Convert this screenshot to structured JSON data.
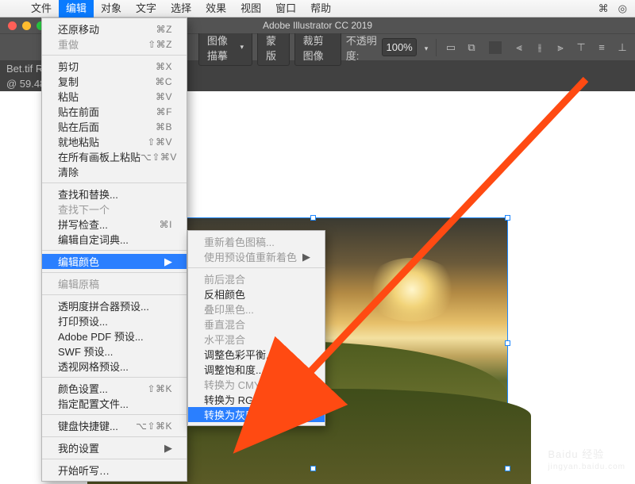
{
  "menubar": {
    "items": [
      "文件",
      "编辑",
      "对象",
      "文字",
      "选择",
      "效果",
      "视图",
      "窗口",
      "帮助"
    ],
    "active_index": 1
  },
  "app": {
    "title": "Adobe Illustrator CC 2019"
  },
  "toolbar": {
    "btn_trace": "图像描摹",
    "btn_mask": "蒙版",
    "btn_crop": "裁剪图像",
    "opacity_label": "不透明度:",
    "opacity_value": "100%"
  },
  "doc": {
    "tab": "Bet.tif    RG",
    "status": "@ 59.48% ⋯"
  },
  "menu_edit": [
    {
      "t": "还原移动",
      "sc": "⌘Z"
    },
    {
      "t": "重做",
      "sc": "⇧⌘Z",
      "disabled": true
    },
    {
      "sep": true
    },
    {
      "t": "剪切",
      "sc": "⌘X"
    },
    {
      "t": "复制",
      "sc": "⌘C"
    },
    {
      "t": "粘贴",
      "sc": "⌘V"
    },
    {
      "t": "贴在前面",
      "sc": "⌘F"
    },
    {
      "t": "贴在后面",
      "sc": "⌘B"
    },
    {
      "t": "就地粘贴",
      "sc": "⇧⌘V"
    },
    {
      "t": "在所有画板上粘贴",
      "sc": "⌥⇧⌘V"
    },
    {
      "t": "清除"
    },
    {
      "sep": true
    },
    {
      "t": "查找和替换..."
    },
    {
      "t": "查找下一个",
      "disabled": true
    },
    {
      "t": "拼写检查...",
      "sc": "⌘I"
    },
    {
      "t": "编辑自定词典..."
    },
    {
      "sep": true
    },
    {
      "t": "编辑颜色",
      "sub": true,
      "hi": true
    },
    {
      "sep": true
    },
    {
      "t": "编辑原稿",
      "disabled": true
    },
    {
      "sep": true
    },
    {
      "t": "透明度拼合器预设..."
    },
    {
      "t": "打印预设..."
    },
    {
      "t": "Adobe PDF 预设..."
    },
    {
      "t": "SWF 预设..."
    },
    {
      "t": "透视网格预设..."
    },
    {
      "sep": true
    },
    {
      "t": "颜色设置...",
      "sc": "⇧⌘K"
    },
    {
      "t": "指定配置文件..."
    },
    {
      "sep": true
    },
    {
      "t": "键盘快捷键...",
      "sc": "⌥⇧⌘K"
    },
    {
      "sep": true
    },
    {
      "t": "我的设置",
      "sub": true
    },
    {
      "sep": true
    },
    {
      "t": "开始听写…"
    }
  ],
  "submenu_color": [
    {
      "t": "重新着色图稿...",
      "disabled": true
    },
    {
      "t": "使用预设值重新着色",
      "sub": true,
      "disabled": true
    },
    {
      "sep": true
    },
    {
      "t": "前后混合",
      "disabled": true
    },
    {
      "t": "反相颜色"
    },
    {
      "t": "叠印黑色...",
      "disabled": true
    },
    {
      "t": "垂直混合",
      "disabled": true
    },
    {
      "t": "水平混合",
      "disabled": true
    },
    {
      "t": "调整色彩平衡..."
    },
    {
      "t": "调整饱和度..."
    },
    {
      "t": "转换为 CMYK",
      "disabled": true
    },
    {
      "t": "转换为 RGB"
    },
    {
      "t": "转换为灰度",
      "hi": true
    }
  ],
  "watermark": {
    "brand": "Baidu 经验",
    "url": "jingyan.baidu.com"
  }
}
